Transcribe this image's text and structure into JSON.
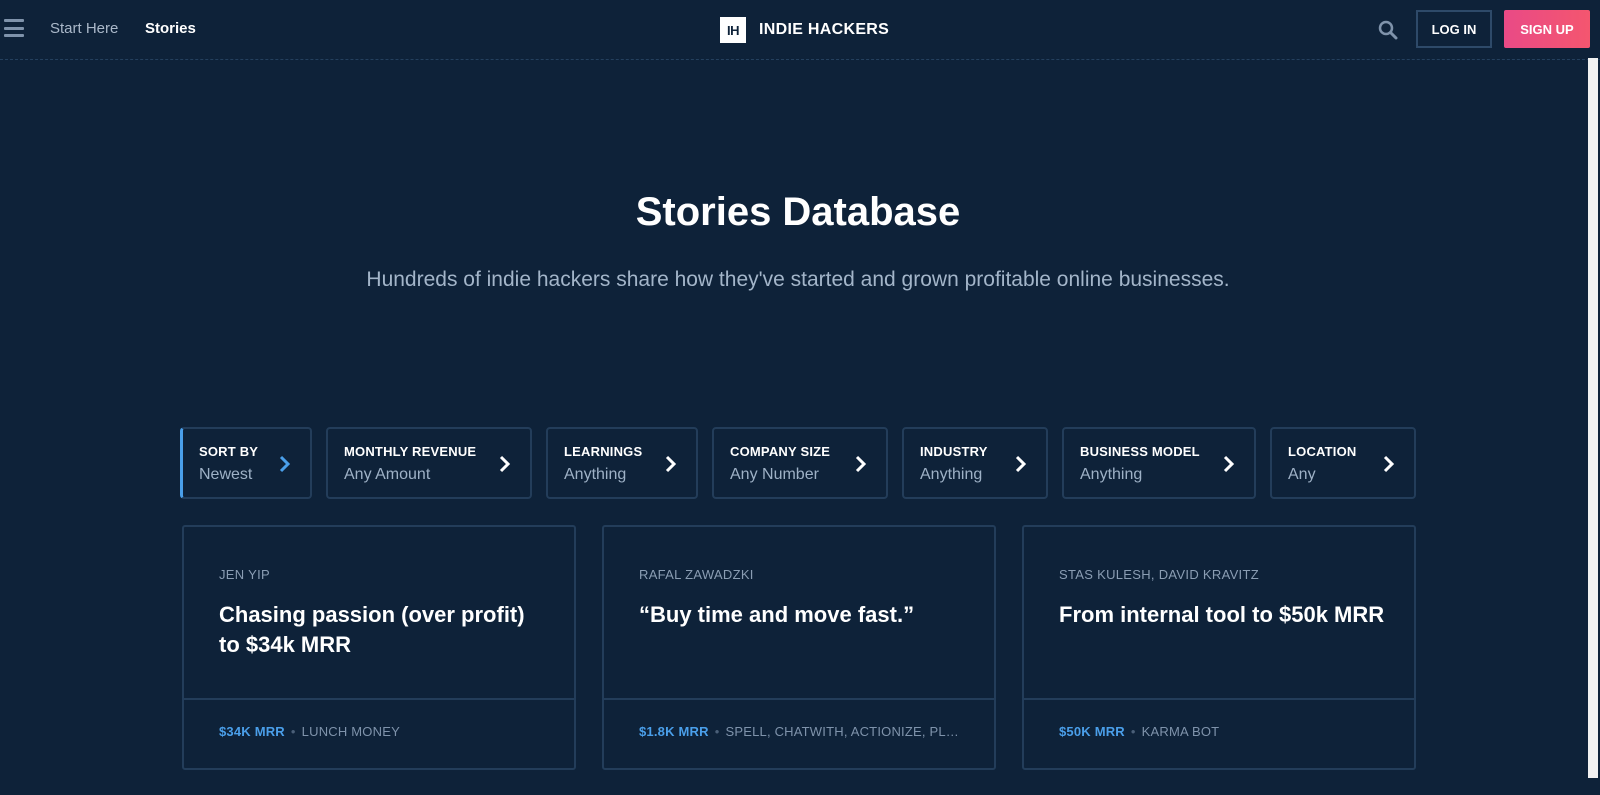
{
  "header": {
    "nav": [
      {
        "label": "Start Here"
      },
      {
        "label": "Stories"
      }
    ],
    "logo_mark": "IH",
    "logo_text": "INDIE HACKERS",
    "login_label": "LOG IN",
    "signup_label": "SIGN UP",
    "icons": {
      "menu": "hamburger-icon",
      "search": "search-icon"
    }
  },
  "hero": {
    "title": "Stories Database",
    "subtitle": "Hundreds of indie hackers share how they've started and grown profitable online businesses."
  },
  "filters": [
    {
      "label": "SORT BY",
      "value": "Newest",
      "active": true
    },
    {
      "label": "MONTHLY REVENUE",
      "value": "Any Amount"
    },
    {
      "label": "LEARNINGS",
      "value": "Anything"
    },
    {
      "label": "COMPANY SIZE",
      "value": "Any Number"
    },
    {
      "label": "INDUSTRY",
      "value": "Anything"
    },
    {
      "label": "BUSINESS MODEL",
      "value": "Anything"
    },
    {
      "label": "LOCATION",
      "value": "Any"
    }
  ],
  "stories": [
    {
      "author": "JEN YIP",
      "title": "Chasing passion (over profit) to $34k MRR",
      "mrr": "$34K MRR",
      "company": "LUNCH MONEY"
    },
    {
      "author": "RAFAL ZAWADZKI",
      "title": "“Buy time and move fast.”",
      "mrr": "$1.8K MRR",
      "company": "SPELL, CHATWITH, ACTIONIZE, PL…"
    },
    {
      "author": "STAS KULESH, DAVID KRAVITZ",
      "title": "From internal tool to $50k MRR",
      "mrr": "$50K MRR",
      "company": "KARMA BOT"
    }
  ],
  "colors": {
    "background": "#0e2239",
    "border": "#233d5a",
    "accent_blue": "#4a9fea",
    "signup_gradient_start": "#e94a86",
    "signup_gradient_end": "#f4566f"
  }
}
